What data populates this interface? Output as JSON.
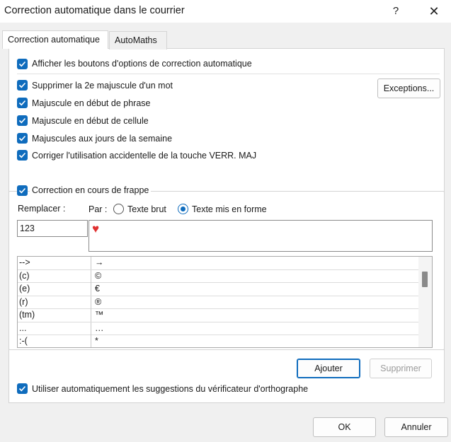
{
  "window": {
    "title": "Correction automatique dans le courrier",
    "help": "?",
    "close": "✕"
  },
  "tabs": [
    "Correction automatique",
    "AutoMaths"
  ],
  "options": {
    "show_buttons": "Afficher les boutons d'options de correction automatique",
    "two_caps": "Supprimer la 2e majuscule d'un mot",
    "sentence_cap": "Majuscule en début de phrase",
    "cell_cap": "Majuscule en début de cellule",
    "day_names": "Majuscules aux jours de la semaine",
    "caps_lock": "Corriger l'utilisation accidentelle de la touche VERR. MAJ",
    "replace_typing": "Correction en cours de frappe",
    "spellcheck": "Utiliser automatiquement les suggestions du vérificateur d'orthographe"
  },
  "buttons": {
    "exceptions": "Exceptions...",
    "add": "Ajouter",
    "delete": "Supprimer",
    "ok": "OK",
    "cancel": "Annuler"
  },
  "replace_label": "Remplacer :",
  "with_label": "Par :",
  "radio": {
    "plain": "Texte brut",
    "formatted": "Texte mis en forme",
    "selected": "formatted"
  },
  "replace_value": "123",
  "with_value": "♥",
  "entries": [
    [
      "-->",
      "→"
    ],
    [
      "(c)",
      "©"
    ],
    [
      "(e)",
      "€"
    ],
    [
      "(r)",
      "®"
    ],
    [
      "(tm)",
      "™"
    ],
    [
      "...",
      "…"
    ],
    [
      ":-(",
      "*"
    ]
  ]
}
